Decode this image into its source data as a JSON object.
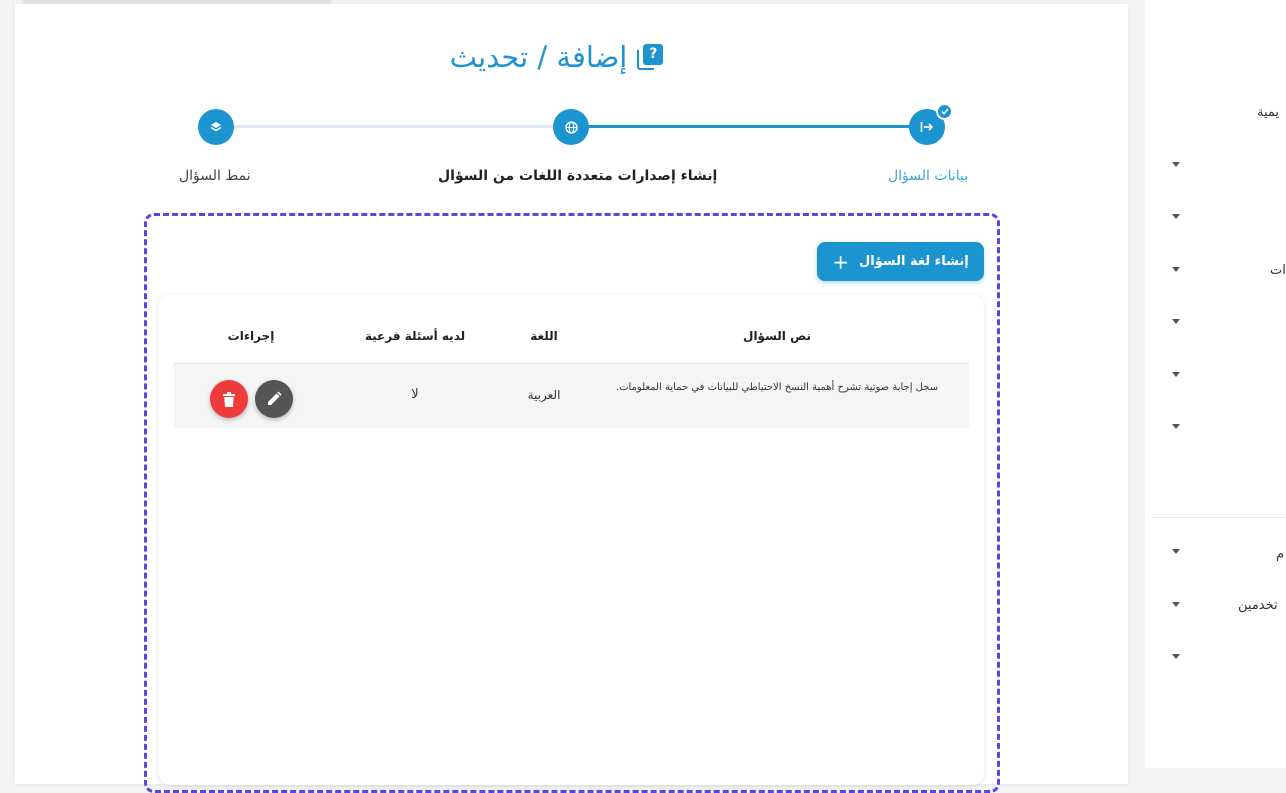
{
  "page": {
    "title": "إضافة / تحديث",
    "title_icon": "question-book-icon"
  },
  "stepper": {
    "steps": [
      {
        "label": "بيانات السؤال",
        "icon": "arrow-right-to-line-icon",
        "state": "completed"
      },
      {
        "label": "إنشاء إصدارات متعددة اللغات من السؤال",
        "icon": "globe-icon",
        "state": "active"
      },
      {
        "label": "نمط السؤال",
        "icon": "layers-icon",
        "state": "pending"
      }
    ]
  },
  "toolbar": {
    "add_language_label": "إنشاء لغة السؤال",
    "add_icon": "+"
  },
  "table": {
    "headers": {
      "question_text": "نص السؤال",
      "language": "اللغة",
      "has_sub_questions": "لديه أسئلة فرعية",
      "actions": "إجراءات"
    },
    "rows": [
      {
        "question_text": "سجل إجابة صوتية تشرح أهمية النسخ الاحتياطي للبيانات في حماية المعلومات.",
        "language": "العربية",
        "has_sub_questions": "لا"
      }
    ]
  },
  "sidebar": {
    "items": [
      {
        "label": "يمية"
      },
      {
        "label": ""
      },
      {
        "label": ""
      },
      {
        "label": "ات"
      },
      {
        "label": ""
      },
      {
        "label": ""
      },
      {
        "label": ""
      },
      {
        "label": "م"
      },
      {
        "label": "تخدمين"
      },
      {
        "label": ""
      }
    ]
  },
  "colors": {
    "primary": "#1c94cf",
    "danger": "#ee3c3c",
    "edit": "#555555",
    "dashed_border": "#5b45e0"
  }
}
